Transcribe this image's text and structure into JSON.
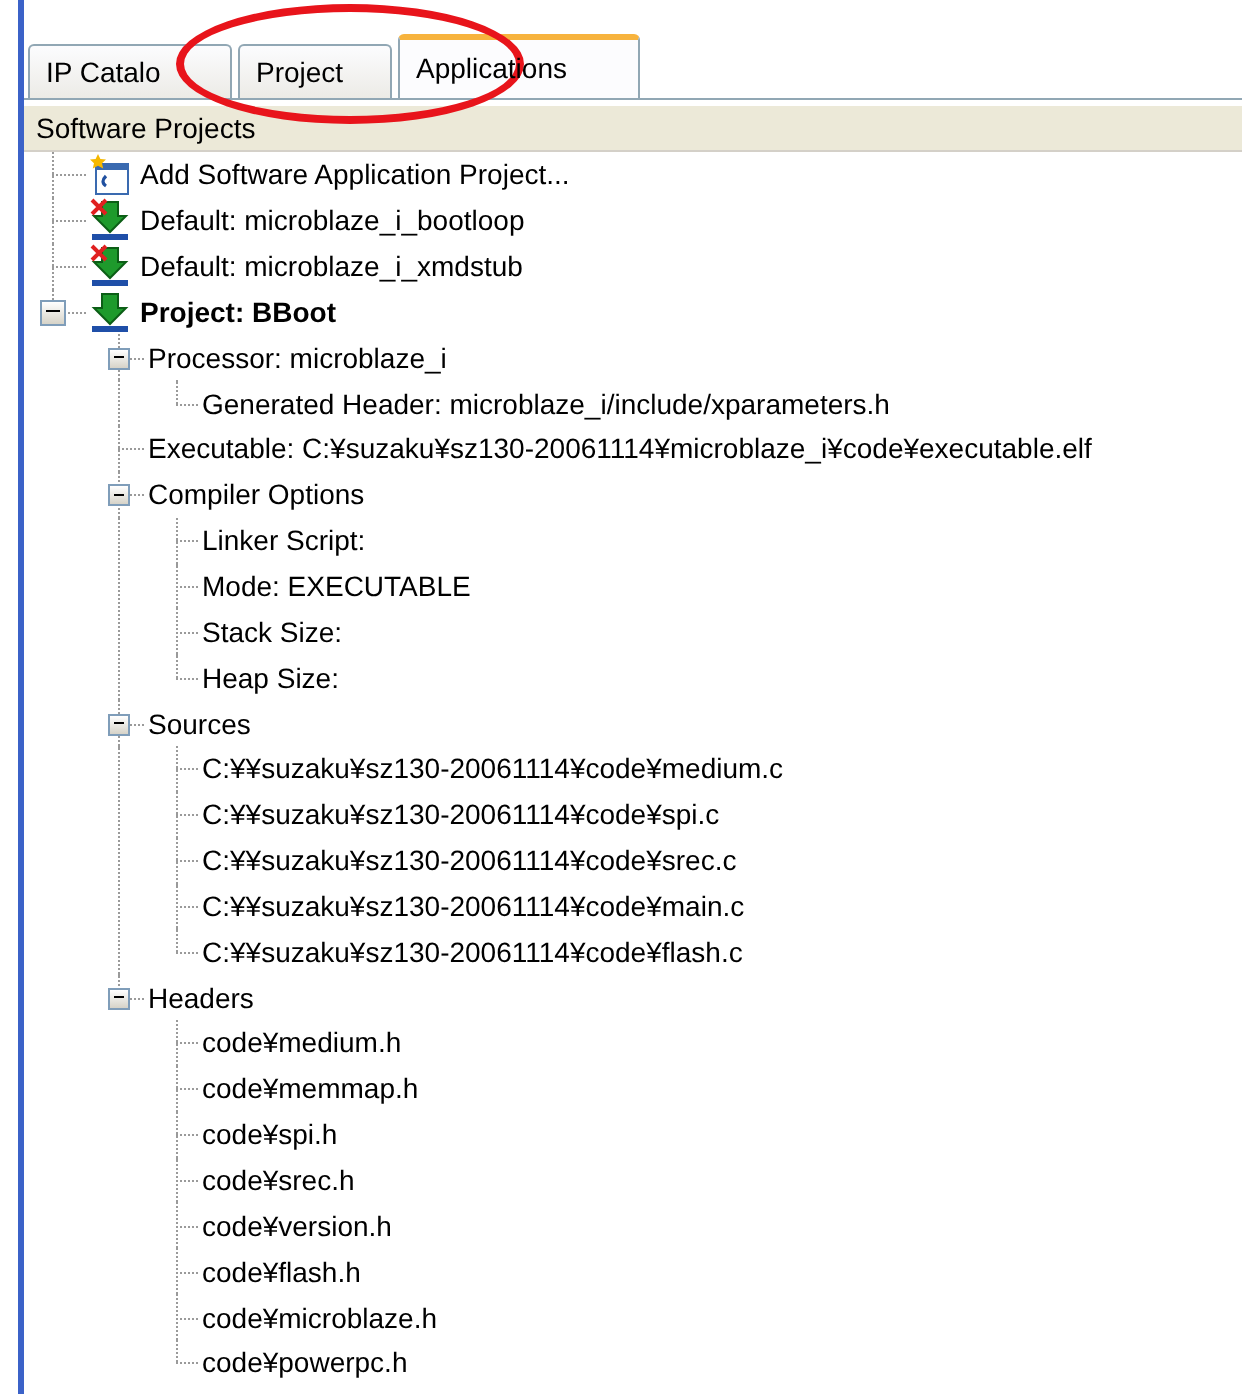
{
  "tabs": [
    {
      "label": "IP Catalo",
      "selected": false
    },
    {
      "label": "Project",
      "selected": false
    },
    {
      "label": "Applications",
      "selected": true
    }
  ],
  "panel": {
    "header": "Software Projects"
  },
  "annotation": {
    "kind": "ellipse",
    "color": "#e8141b"
  },
  "tree": [
    {
      "label": "Add Software Application Project...",
      "kind": "add"
    },
    {
      "label": "Default: microblaze_i_bootloop",
      "kind": "default"
    },
    {
      "label": "Default: microblaze_i_xmdstub",
      "kind": "default"
    },
    {
      "label": "Project: BBoot",
      "kind": "project",
      "expanded": true,
      "children": [
        {
          "label": "Processor: microblaze_i",
          "expanded": true,
          "children": [
            {
              "label": "Generated Header: microblaze_i/include/xparameters.h"
            }
          ]
        },
        {
          "label": "Executable: C:¥suzaku¥sz130-20061114¥microblaze_i¥code¥executable.elf"
        },
        {
          "label": "Compiler Options",
          "expanded": true,
          "children": [
            {
              "label": "Linker Script:"
            },
            {
              "label": "Mode: EXECUTABLE"
            },
            {
              "label": "Stack Size:"
            },
            {
              "label": "Heap Size:"
            }
          ]
        },
        {
          "label": "Sources",
          "expanded": true,
          "children": [
            {
              "label": "C:¥¥suzaku¥sz130-20061114¥code¥medium.c"
            },
            {
              "label": "C:¥¥suzaku¥sz130-20061114¥code¥spi.c"
            },
            {
              "label": "C:¥¥suzaku¥sz130-20061114¥code¥srec.c"
            },
            {
              "label": "C:¥¥suzaku¥sz130-20061114¥code¥main.c"
            },
            {
              "label": "C:¥¥suzaku¥sz130-20061114¥code¥flash.c"
            }
          ]
        },
        {
          "label": "Headers",
          "expanded": true,
          "children": [
            {
              "label": "code¥medium.h"
            },
            {
              "label": "code¥memmap.h"
            },
            {
              "label": "code¥spi.h"
            },
            {
              "label": "code¥srec.h"
            },
            {
              "label": "code¥version.h"
            },
            {
              "label": "code¥flash.h"
            },
            {
              "label": "code¥microblaze.h"
            },
            {
              "label": "code¥powerpc.h"
            }
          ]
        }
      ]
    }
  ]
}
